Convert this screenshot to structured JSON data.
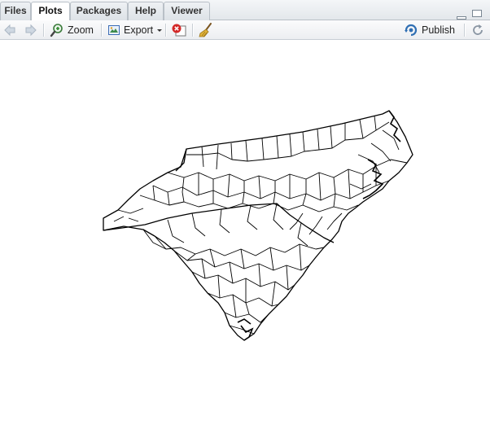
{
  "tabs": [
    {
      "label": "Files",
      "active": false
    },
    {
      "label": "Plots",
      "active": true
    },
    {
      "label": "Packages",
      "active": false
    },
    {
      "label": "Help",
      "active": false
    },
    {
      "label": "Viewer",
      "active": false
    }
  ],
  "toolbar": {
    "back_icon": "arrow-left-icon",
    "forward_icon": "arrow-right-icon",
    "zoom_label": "Zoom",
    "zoom_icon": "zoom-magnifier-icon",
    "export_label": "Export",
    "export_icon": "export-image-icon",
    "remove_icon": "remove-plot-icon",
    "clear_icon": "broom-icon",
    "publish_label": "Publish",
    "publish_icon": "publish-icon",
    "refresh_icon": "refresh-icon"
  },
  "plot": {
    "description_icon": "county-map-plot",
    "stroke_color": "#000000",
    "background": "#ffffff"
  },
  "colors": {
    "accent_blue": "#2f6fb3",
    "remove_red": "#cc2222"
  }
}
